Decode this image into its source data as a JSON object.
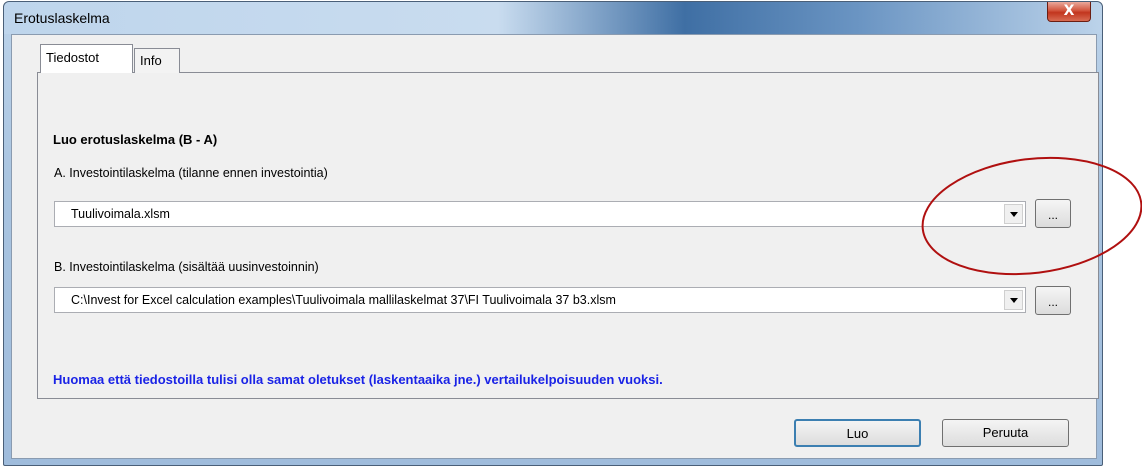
{
  "window": {
    "title": "Erotuslaskelma",
    "close_label": "X"
  },
  "tabs": [
    {
      "label": "Tiedostot",
      "active": true
    },
    {
      "label": "Info",
      "active": false
    }
  ],
  "panel": {
    "heading": "Luo erotuslaskelma (B - A)",
    "field_a": {
      "label": "A. Investointilaskelma (tilanne ennen investointia)",
      "value": "Tuulivoimala.xlsm",
      "browse_label": "..."
    },
    "field_b": {
      "label": "B. Investointilaskelma (sisältää uusinvestoinnin)",
      "value": "C:\\Invest for Excel calculation examples\\Tuulivoimala mallilaskelmat 37\\FI Tuulivoimala 37 b3.xlsm",
      "browse_label": "..."
    },
    "note": "Huomaa että tiedostoilla tulisi olla samat oletukset (laskentaaika jne.) vertailukelpoisuuden vuoksi."
  },
  "buttons": {
    "create": "Luo",
    "cancel": "Peruuta"
  },
  "colors": {
    "note_text": "#1a23e6",
    "annotation_ellipse": "#b01010",
    "close_button": "#c9442a"
  }
}
